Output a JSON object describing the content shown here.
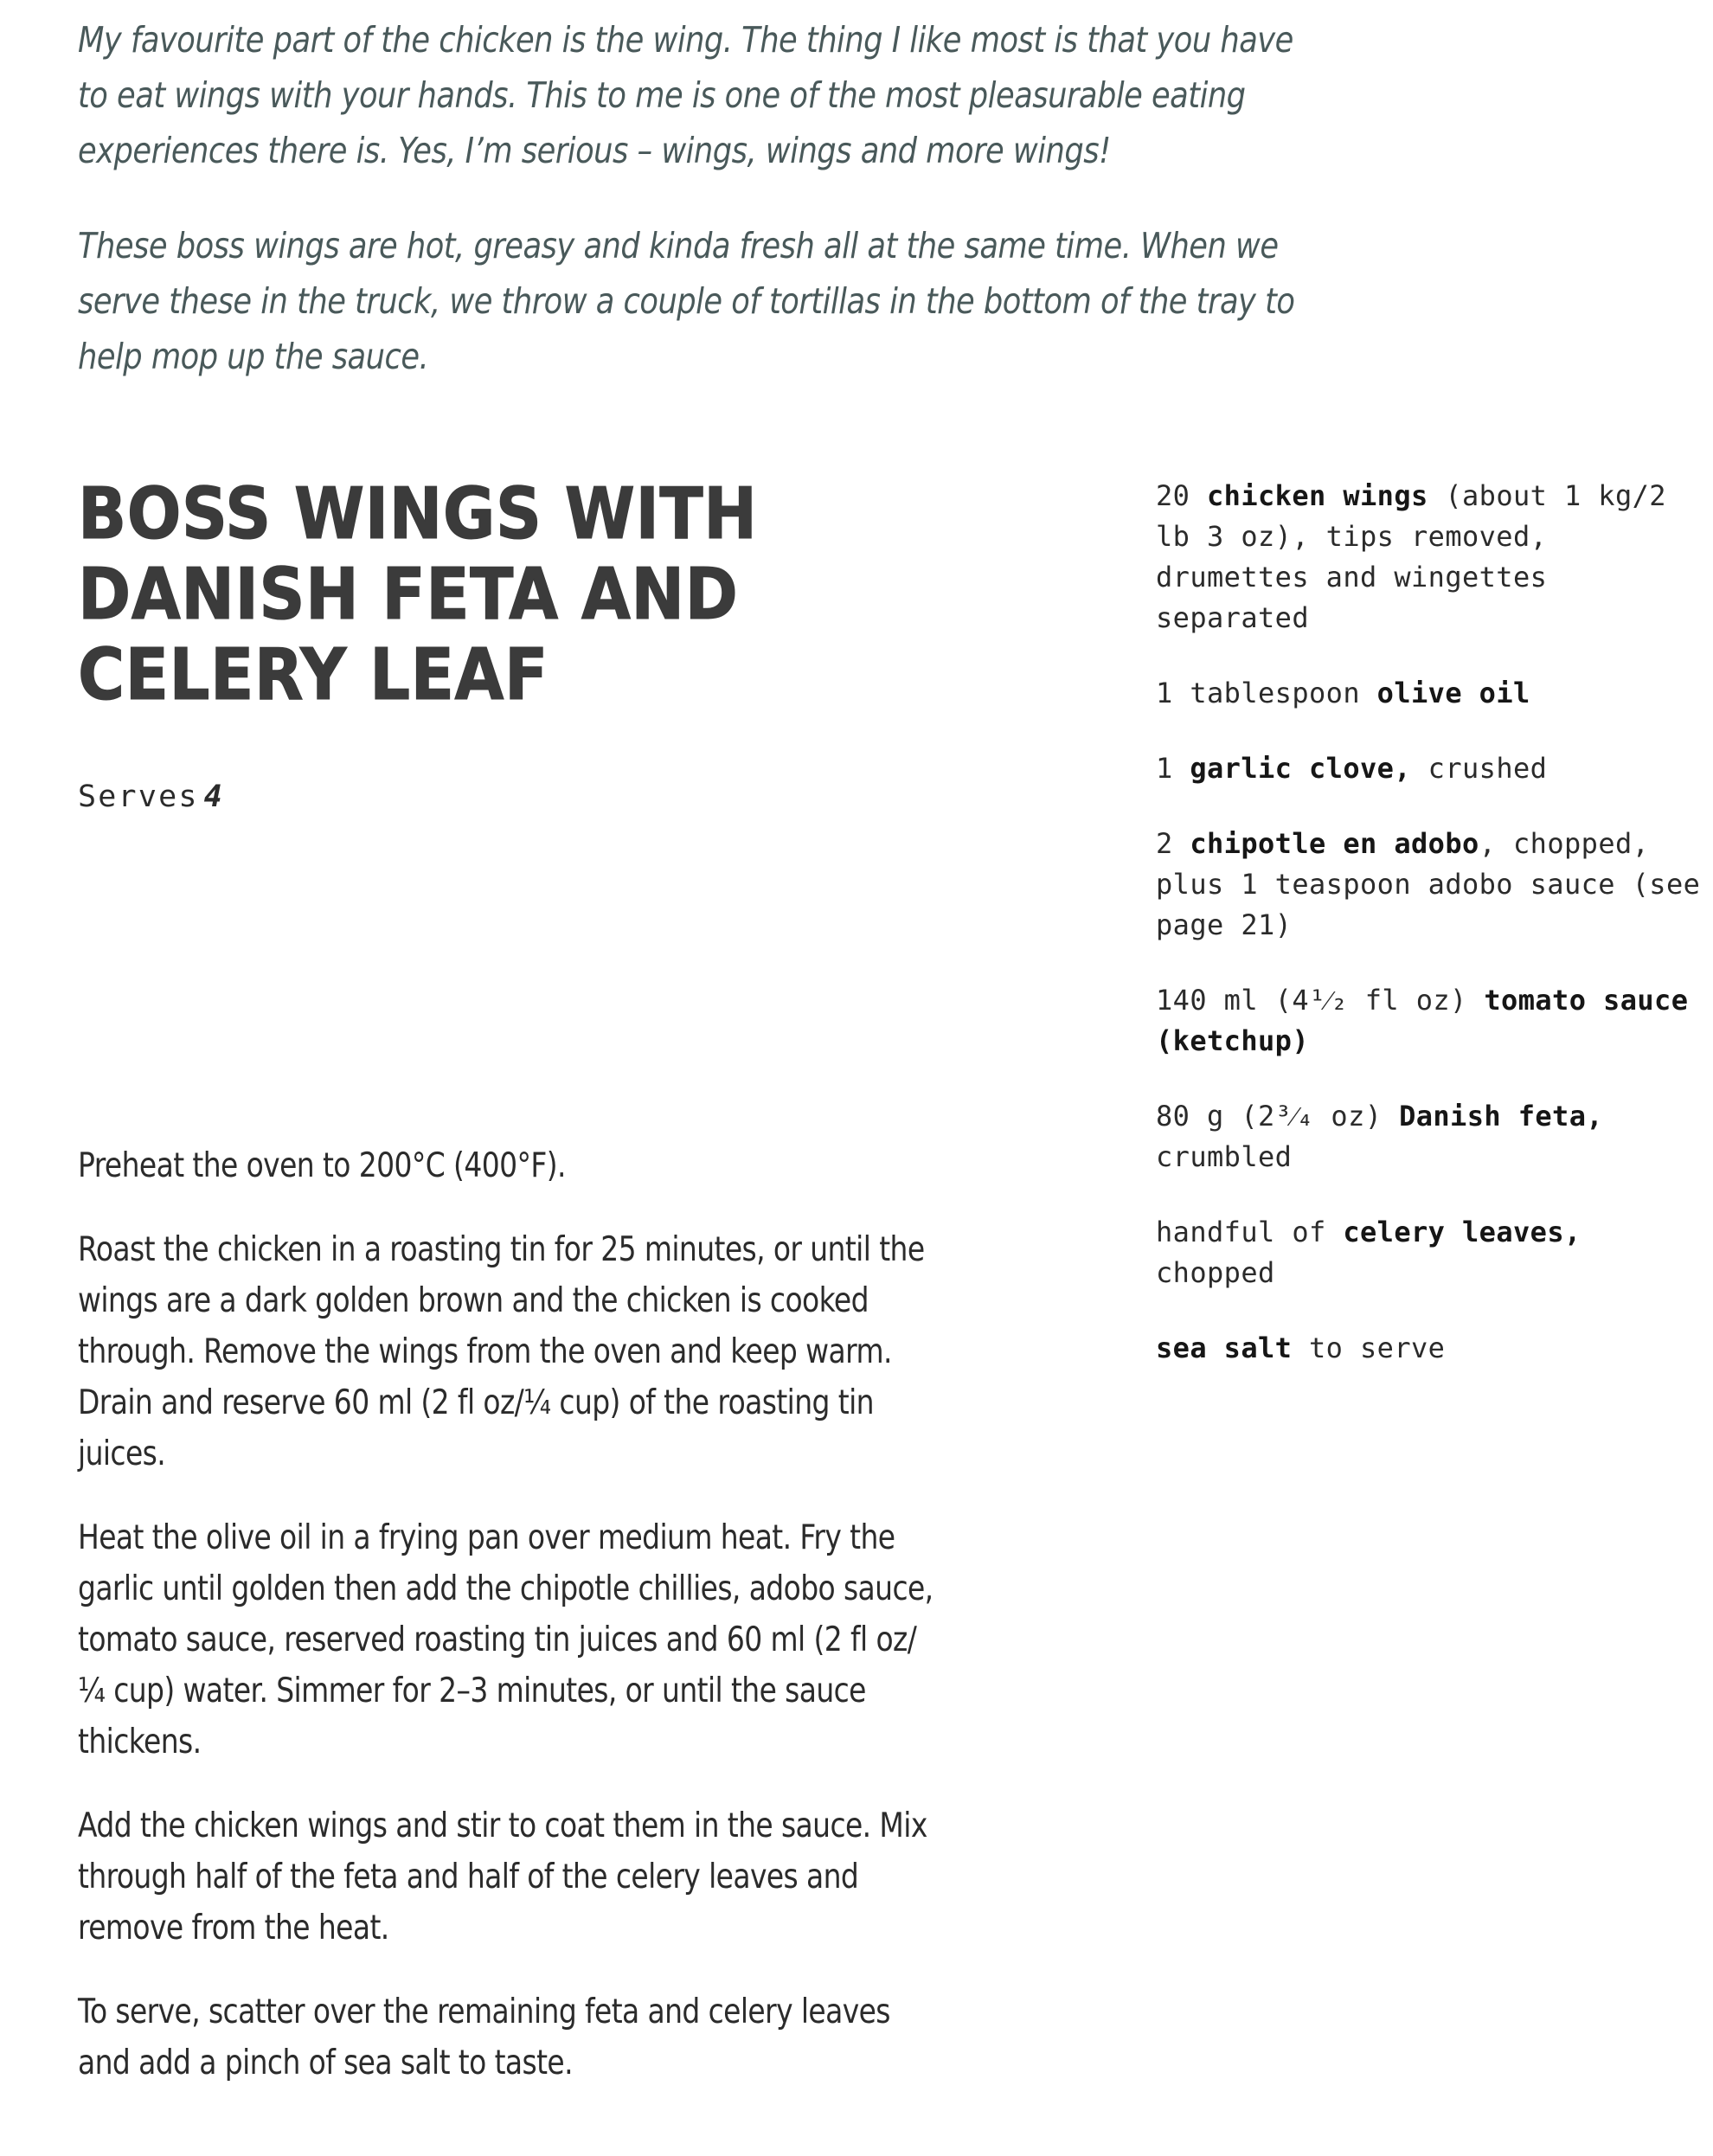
{
  "page": {
    "background_color": "#ffffff",
    "intro_text_color": "#49595a",
    "body_text_color": "#2b2b2b",
    "title_color": "#3b3b3b"
  },
  "intro": {
    "paragraphs": [
      "My favourite part of the chicken is the wing. The thing I like most is that you have to eat wings with your hands. This to me is one of the most pleasurable eating experiences there is. Yes, I’m serious – wings, wings and more wings!",
      "These boss wings are hot, greasy and kinda fresh all at the same time. When we serve these in the truck, we throw a couple of tortillas in the bottom of the tray to help mop up the sauce."
    ]
  },
  "recipe": {
    "title_lines": [
      "BOSS WINGS WITH",
      "DANISH FETA AND",
      "CELERY LEAF"
    ],
    "serves_label": "Serves",
    "serves_count": "4"
  },
  "ingredients": [
    {
      "parts": [
        {
          "text": "20 ",
          "bold": false
        },
        {
          "text": "chicken wings",
          "bold": true
        },
        {
          "text": " (about 1 kg/2 lb 3 oz), tips removed, drumettes and wingettes separated",
          "bold": false
        }
      ]
    },
    {
      "parts": [
        {
          "text": "1 tablespoon ",
          "bold": false
        },
        {
          "text": "olive oil",
          "bold": true
        }
      ]
    },
    {
      "parts": [
        {
          "text": "1 ",
          "bold": false
        },
        {
          "text": "garlic clove,",
          "bold": true
        },
        {
          "text": " crushed",
          "bold": false
        }
      ]
    },
    {
      "parts": [
        {
          "text": "2 ",
          "bold": false
        },
        {
          "text": "chipotle en adobo",
          "bold": true
        },
        {
          "text": ", chopped, plus 1 teaspoon adobo sauce (see page 21)",
          "bold": false
        }
      ]
    },
    {
      "parts": [
        {
          "text": "140 ml (4¹⁄₂ fl oz) ",
          "bold": false
        },
        {
          "text": "tomato sauce (ketchup)",
          "bold": true
        }
      ]
    },
    {
      "parts": [
        {
          "text": "80 g (2³⁄₄ oz) ",
          "bold": false
        },
        {
          "text": "Danish feta,",
          "bold": true
        },
        {
          "text": " crumbled",
          "bold": false
        }
      ]
    },
    {
      "parts": [
        {
          "text": "handful of ",
          "bold": false
        },
        {
          "text": "celery leaves,",
          "bold": true
        },
        {
          "text": " chopped",
          "bold": false
        }
      ]
    },
    {
      "parts": [
        {
          "text": "sea salt",
          "bold": true
        },
        {
          "text": " to serve",
          "bold": false
        }
      ]
    }
  ],
  "method": {
    "steps": [
      "Preheat the oven to 200°C (400°F).",
      "Roast the chicken in a roasting tin for 25 minutes, or until the wings are a dark golden brown and the chicken is cooked through. Remove the wings from the oven and keep warm. Drain and reserve 60 ml (2 fl oz/¼ cup) of the roasting tin juices.",
      "Heat the olive oil in a frying pan over medium heat. Fry the garlic until golden then add the chipotle chillies, adobo sauce, tomato sauce, reserved roasting tin juices and 60 ml (2 fl oz/¼ cup) water. Simmer for 2–3 minutes, or until the sauce thickens.",
      "Add the chicken wings and stir to coat them in the sauce. Mix through half of the feta and half of the celery leaves and remove from the heat.",
      "To serve, scatter over the remaining feta and celery leaves and add a pinch of sea salt to taste."
    ]
  }
}
